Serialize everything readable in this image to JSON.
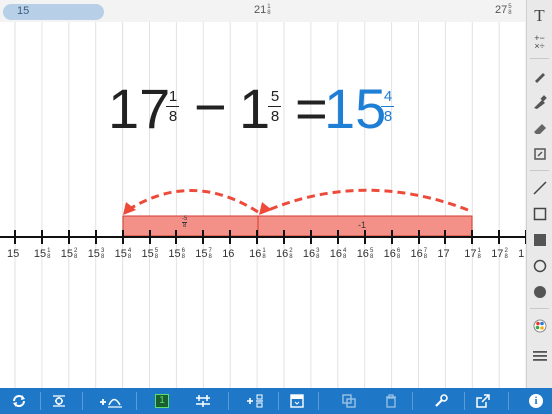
{
  "scroller": {
    "left_label": "15",
    "mid_whole": "21",
    "mid_num": "1",
    "mid_den": "8",
    "right_whole": "27",
    "right_num": "5",
    "right_den": "8"
  },
  "equation": {
    "a_whole": "17",
    "a_num": "1",
    "a_den": "8",
    "operator": "−",
    "b_whole": "1",
    "b_num": "5",
    "b_den": "8",
    "equals": "=",
    "r_whole": "15",
    "r_num": "4",
    "r_den": "8",
    "result_color": "#1f7fd4"
  },
  "jumps": {
    "small_label_num": "5",
    "small_label_den": "8",
    "small_label_sign": "-",
    "whole_label": "-1",
    "color": "#ee4a3a",
    "fill": "#f39189"
  },
  "number_line": {
    "ticks": [
      {
        "w": "15",
        "n": "",
        "d": ""
      },
      {
        "w": "15",
        "n": "1",
        "d": "8"
      },
      {
        "w": "15",
        "n": "2",
        "d": "8"
      },
      {
        "w": "15",
        "n": "3",
        "d": "8"
      },
      {
        "w": "15",
        "n": "4",
        "d": "8"
      },
      {
        "w": "15",
        "n": "5",
        "d": "8"
      },
      {
        "w": "15",
        "n": "6",
        "d": "8"
      },
      {
        "w": "15",
        "n": "7",
        "d": "8"
      },
      {
        "w": "16",
        "n": "",
        "d": ""
      },
      {
        "w": "16",
        "n": "1",
        "d": "8"
      },
      {
        "w": "16",
        "n": "2",
        "d": "8"
      },
      {
        "w": "16",
        "n": "3",
        "d": "8"
      },
      {
        "w": "16",
        "n": "4",
        "d": "8"
      },
      {
        "w": "16",
        "n": "5",
        "d": "8"
      },
      {
        "w": "16",
        "n": "6",
        "d": "8"
      },
      {
        "w": "16",
        "n": "7",
        "d": "8"
      },
      {
        "w": "17",
        "n": "",
        "d": ""
      },
      {
        "w": "17",
        "n": "1",
        "d": "8"
      },
      {
        "w": "17",
        "n": "2",
        "d": "8"
      },
      {
        "w": "1",
        "n": "",
        "d": ""
      }
    ]
  },
  "side_tools": [
    {
      "name": "text-tool",
      "icon": "text-icon"
    },
    {
      "name": "operators-tool",
      "icon": "operators-icon"
    },
    {
      "name": "pencil-tool",
      "icon": "pencil-icon"
    },
    {
      "name": "marker-tool",
      "icon": "marker-icon"
    },
    {
      "name": "eraser-tool",
      "icon": "eraser-icon"
    },
    {
      "name": "clear-tool",
      "icon": "clear-icon"
    },
    {
      "name": "line-tool",
      "icon": "line-icon"
    },
    {
      "name": "rectangle-outline-tool",
      "icon": "rectangle-outline-icon"
    },
    {
      "name": "rectangle-filled-tool",
      "icon": "rectangle-filled-icon"
    },
    {
      "name": "circle-outline-tool",
      "icon": "circle-outline-icon"
    },
    {
      "name": "circle-filled-tool",
      "icon": "circle-filled-icon"
    },
    {
      "name": "color-picker-tool",
      "icon": "color-palette-icon"
    },
    {
      "name": "menu-tool",
      "icon": "menu-icon"
    }
  ],
  "bottom_buttons": [
    {
      "name": "refresh-button",
      "icon": "refresh-icon"
    },
    {
      "name": "settings-button",
      "icon": "settings-icon"
    },
    {
      "name": "add-jump-button",
      "icon": "add-jump-icon"
    },
    {
      "name": "unit-button",
      "icon": "unit-icon",
      "label": "1"
    },
    {
      "name": "partition-button",
      "icon": "partition-icon"
    },
    {
      "name": "add-fraction-button",
      "icon": "add-fraction-icon"
    },
    {
      "name": "hide-button",
      "icon": "hide-icon"
    },
    {
      "name": "duplicate-button",
      "icon": "duplicate-icon"
    },
    {
      "name": "delete-button",
      "icon": "trash-icon"
    },
    {
      "name": "tools-button",
      "icon": "wrench-icon"
    },
    {
      "name": "share-button",
      "icon": "share-icon"
    },
    {
      "name": "info-button",
      "icon": "info-icon"
    }
  ]
}
